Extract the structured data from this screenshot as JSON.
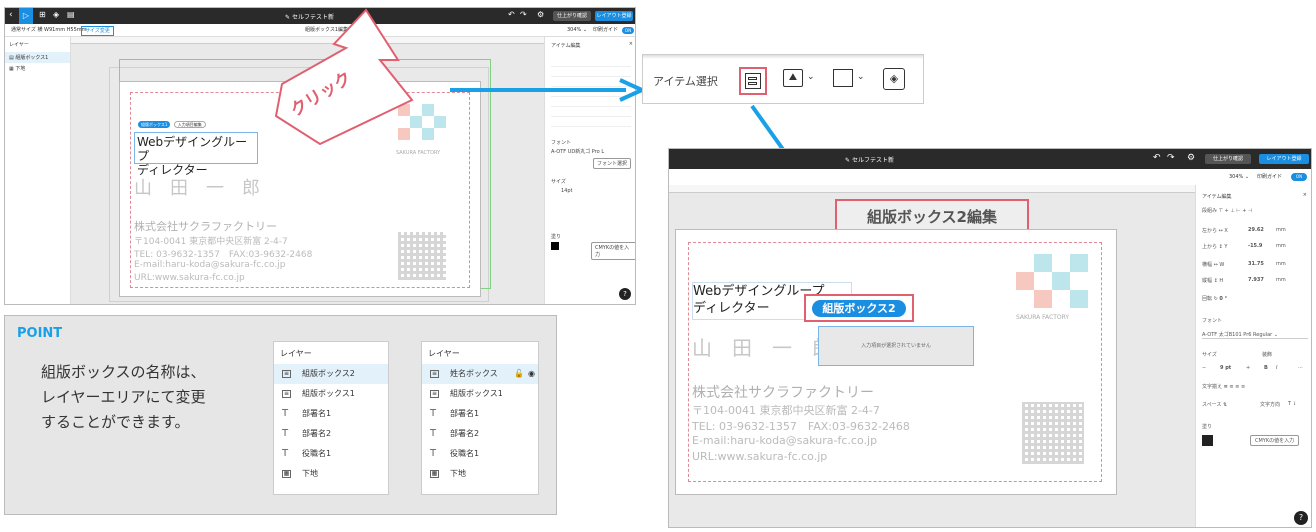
{
  "left_screen": {
    "doc_title": "セルフテスト新",
    "finish_check": "仕上がり確認",
    "layout_register": "レイアウト登録",
    "size_label": "通常サイズ 横 W91mm H55mm",
    "size_change": "サイズ変更",
    "breadcrumb": "組版ボックス1編集",
    "zoom": "304% ⌄",
    "print_guide": "印刷ガイド",
    "toggle": "ON",
    "layers_title": "レイヤー",
    "layers": [
      "組版ボックス1",
      "下地"
    ],
    "panel_title": "アイテム編集",
    "font_label": "フォント",
    "font_name": "A-OTF UD新丸ゴ Pro L",
    "font_select": "フォント選択",
    "size_label2": "サイズ",
    "font_size": "14pt",
    "fill_label": "塗り",
    "cmyk_button": "CMYKの値を入力",
    "help": "?",
    "click_label": "クリック",
    "tag1": "組版ボックス1",
    "tag2": "入力項目編集"
  },
  "card": {
    "title_line1": "Webデザイングループ",
    "title_line2": "ディレクター",
    "name": "山　田　一　郎",
    "company": "株式会社サクラファクトリー",
    "address": "〒104-0041 東京都中央区新富 2-4-7",
    "tel": "TEL: 03-9632-1357　FAX:03-9632-2468",
    "email": "E-mail:haru-koda@sakura-fc.co.jp",
    "url": "URL:www.sakura-fc.co.jp",
    "logo_text": "SAKURA FACTORY"
  },
  "toolbar_zoom": {
    "label": "アイテム選択"
  },
  "point": {
    "heading": "POINT",
    "line1": "組版ボックスの名称は、",
    "line2": "レイヤーエリアにて変更",
    "line3": "することができます。"
  },
  "layer_before": {
    "title": "レイヤー",
    "items": [
      "組版ボックス2",
      "組版ボックス1",
      "部署名1",
      "部署名2",
      "役職名1",
      "下地"
    ]
  },
  "layer_after": {
    "title": "レイヤー",
    "items": [
      "姓名ボックス",
      "組版ボックス1",
      "部署名1",
      "部署名2",
      "役職名1",
      "下地"
    ]
  },
  "right_screen": {
    "doc_title": "セルフテスト新",
    "finish_check": "仕上がり確認",
    "layout_register": "レイアウト登録",
    "zoom": "304% ⌄",
    "print_guide": "印刷ガイド",
    "toggle": "ON",
    "breadcrumb": "組版ボックス2編集",
    "box_tag": "組版ボックス2",
    "empty_box_text": "入力項目が選択されていません",
    "panel_title": "アイテム編集",
    "align_label": "段組み",
    "left_label": "左から",
    "left_axis": "X",
    "left_value": "29.62",
    "top_label": "上から",
    "top_axis": "Y",
    "top_value": "-15.9",
    "width_label": "横幅",
    "width_axis": "W",
    "width_value": "31.75",
    "height_label": "縦幅",
    "height_axis": "H",
    "height_value": "7.937",
    "unit": "mm",
    "rotate_label": "回転",
    "rotate_value": "0 °",
    "font_label": "フォント",
    "font_name": "A-OTF 太ゴB101 Pr6 Regular",
    "size_label": "サイズ",
    "deco_label": "装飾",
    "font_size": "9 pt",
    "bold": "B",
    "italic": "I",
    "align2_label": "文字揃え",
    "space_label": "スペース",
    "direction_label": "文字方向",
    "fill_label": "塗り",
    "cmyk_button": "CMYKの値を入力",
    "help": "?"
  }
}
